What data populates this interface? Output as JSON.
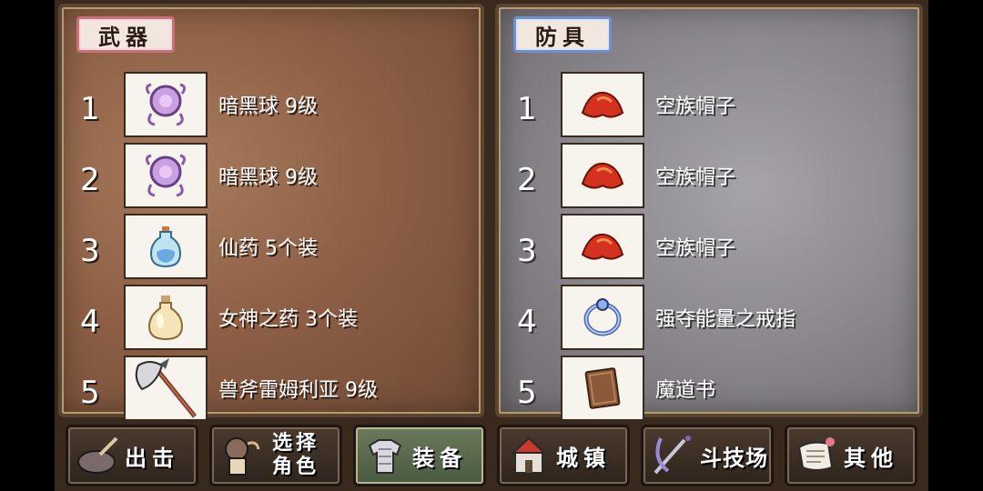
{
  "weapons": {
    "title": "武器",
    "items": [
      {
        "num": "1",
        "name": "暗黑球 9级",
        "icon": "dark-orb-icon"
      },
      {
        "num": "2",
        "name": "暗黑球 9级",
        "icon": "dark-orb-icon"
      },
      {
        "num": "3",
        "name": "仙药 5个装",
        "icon": "elixir-bottle-icon"
      },
      {
        "num": "4",
        "name": "女神之药 3个装",
        "icon": "goddess-potion-icon"
      },
      {
        "num": "5",
        "name": "兽斧雷姆利亚 9级",
        "icon": "beast-axe-icon"
      }
    ]
  },
  "armor": {
    "title": "防具",
    "items": [
      {
        "num": "1",
        "name": "空族帽子",
        "icon": "red-hat-icon"
      },
      {
        "num": "2",
        "name": "空族帽子",
        "icon": "red-hat-icon"
      },
      {
        "num": "3",
        "name": "空族帽子",
        "icon": "red-hat-icon"
      },
      {
        "num": "4",
        "name": "强夺能量之戒指",
        "icon": "ring-icon"
      },
      {
        "num": "5",
        "name": "魔道书",
        "icon": "spellbook-icon"
      }
    ]
  },
  "nav": {
    "sortie": "出击",
    "select_line1": "选择",
    "select_line2": "角色",
    "equip": "装备",
    "town": "城镇",
    "arena": "斗技场",
    "other": "其他"
  }
}
